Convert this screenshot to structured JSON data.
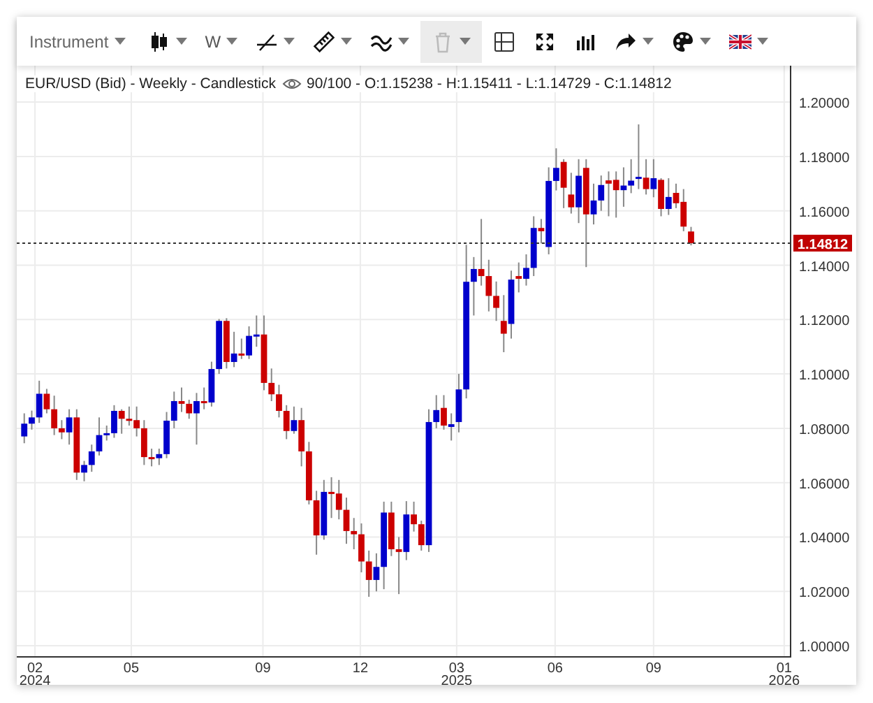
{
  "toolbar": {
    "items": [
      {
        "kind": "text",
        "label": "Instrument",
        "menu": true,
        "disabled": false
      },
      {
        "kind": "icon",
        "menu": true,
        "disabled": false
      },
      {
        "kind": "text",
        "label": "W",
        "menu": true,
        "disabled": false
      },
      {
        "kind": "icon",
        "menu": true,
        "disabled": false
      },
      {
        "kind": "icon",
        "menu": true,
        "disabled": false
      },
      {
        "kind": "icon",
        "menu": true,
        "disabled": false
      },
      {
        "kind": "icon",
        "menu": true,
        "disabled": true
      },
      {
        "kind": "icon",
        "menu": false,
        "disabled": false
      },
      {
        "kind": "icon",
        "menu": false,
        "disabled": false
      },
      {
        "kind": "icon",
        "menu": false,
        "disabled": false
      },
      {
        "kind": "icon",
        "menu": true,
        "disabled": false
      },
      {
        "kind": "icon",
        "menu": true,
        "disabled": false
      },
      {
        "kind": "icon",
        "menu": true,
        "disabled": false
      }
    ]
  },
  "chart": {
    "legend": {
      "title": "EUR/USD (Bid) - Weekly - Candlestick",
      "details": "90/100 - O:1.15238 - H:1.15411 - L:1.14729 - C:1.14812"
    },
    "year_labels": [
      "2024",
      "2025",
      "2026"
    ],
    "chart_data": {
      "type": "candlestick",
      "xlim": [
        "2024-01-15",
        "2026-01-07"
      ],
      "ylim": [
        0.9959,
        1.2134
      ],
      "yticks": [
        {
          "value": 1.2,
          "label": "1.20000"
        },
        {
          "value": 1.18,
          "label": "1.18000"
        },
        {
          "value": 1.16,
          "label": "1.16000"
        },
        {
          "value": 1.14,
          "label": "1.14000"
        },
        {
          "value": 1.12,
          "label": "1.12000"
        },
        {
          "value": 1.1,
          "label": "1.10000"
        },
        {
          "value": 1.08,
          "label": "1.08000"
        },
        {
          "value": 1.06,
          "label": "1.06000"
        },
        {
          "value": 1.04,
          "label": "1.04000"
        },
        {
          "value": 1.02,
          "label": "1.02000"
        },
        {
          "value": 1.0,
          "label": "1.00000"
        }
      ],
      "xticks": [
        {
          "value": "2024-02-01",
          "label": "02"
        },
        {
          "value": "2024-05-01",
          "label": "05"
        },
        {
          "value": "2024-09-01",
          "label": "09"
        },
        {
          "value": "2024-12-01",
          "label": "12"
        },
        {
          "value": "2025-03-01",
          "label": "03"
        },
        {
          "value": "2025-06-01",
          "label": "06"
        },
        {
          "value": "2025-09-01",
          "label": "09"
        },
        {
          "value": "2026-01-01",
          "label": "01"
        }
      ],
      "x": [
        "2024-01-22",
        "2024-01-29",
        "2024-02-05",
        "2024-02-12",
        "2024-02-19",
        "2024-02-26",
        "2024-03-04",
        "2024-03-11",
        "2024-03-18",
        "2024-03-25",
        "2024-04-01",
        "2024-04-08",
        "2024-04-15",
        "2024-04-22",
        "2024-04-29",
        "2024-05-06",
        "2024-05-13",
        "2024-05-20",
        "2024-05-27",
        "2024-06-03",
        "2024-06-10",
        "2024-06-17",
        "2024-06-24",
        "2024-07-01",
        "2024-07-08",
        "2024-07-15",
        "2024-07-22",
        "2024-07-29",
        "2024-08-05",
        "2024-08-12",
        "2024-08-19",
        "2024-08-26",
        "2024-09-02",
        "2024-09-09",
        "2024-09-16",
        "2024-09-23",
        "2024-09-30",
        "2024-10-07",
        "2024-10-14",
        "2024-10-21",
        "2024-10-28",
        "2024-11-04",
        "2024-11-11",
        "2024-11-18",
        "2024-11-25",
        "2024-12-02",
        "2024-12-09",
        "2024-12-16",
        "2024-12-23",
        "2024-12-30",
        "2025-01-06",
        "2025-01-13",
        "2025-01-20",
        "2025-01-27",
        "2025-02-03",
        "2025-02-10",
        "2025-02-17",
        "2025-02-24",
        "2025-03-03",
        "2025-03-10",
        "2025-03-17",
        "2025-03-24",
        "2025-03-31",
        "2025-04-07",
        "2025-04-14",
        "2025-04-21",
        "2025-04-28",
        "2025-05-05",
        "2025-05-12",
        "2025-05-19",
        "2025-05-26",
        "2025-06-02",
        "2025-06-09",
        "2025-06-16",
        "2025-06-23",
        "2025-06-30",
        "2025-07-07",
        "2025-07-14",
        "2025-07-21",
        "2025-07-28",
        "2025-08-04",
        "2025-08-11",
        "2025-08-18",
        "2025-08-25",
        "2025-09-01",
        "2025-09-08",
        "2025-09-15",
        "2025-09-22",
        "2025-09-29",
        "2025-10-06"
      ],
      "ohlc": [
        [
          1.077,
          1.0855,
          1.0745,
          1.0817
        ],
        [
          1.0817,
          1.0865,
          1.0795,
          1.084
        ],
        [
          1.084,
          1.0975,
          1.082,
          1.0927
        ],
        [
          1.0927,
          1.0945,
          1.0855,
          1.087
        ],
        [
          1.087,
          1.092,
          1.0775,
          1.08
        ],
        [
          1.08,
          1.083,
          1.076,
          1.0785
        ],
        [
          1.0785,
          1.087,
          1.074,
          1.084
        ],
        [
          1.084,
          1.087,
          1.061,
          1.0637
        ],
        [
          1.0637,
          1.068,
          1.0605,
          1.0665
        ],
        [
          1.0665,
          1.074,
          1.064,
          1.0715
        ],
        [
          1.0715,
          1.084,
          1.07,
          1.0775
        ],
        [
          1.0775,
          1.081,
          1.0755,
          1.0782
        ],
        [
          1.0782,
          1.0885,
          1.0765,
          1.0864
        ],
        [
          1.0864,
          1.087,
          1.078,
          1.0835
        ],
        [
          1.0835,
          1.088,
          1.081,
          1.083
        ],
        [
          1.083,
          1.088,
          1.077,
          1.08
        ],
        [
          1.08,
          1.083,
          1.0665,
          1.0694
        ],
        [
          1.0694,
          1.0725,
          1.066,
          1.069
        ],
        [
          1.069,
          1.0725,
          1.0665,
          1.0705
        ],
        [
          1.0705,
          1.086,
          1.069,
          1.0828
        ],
        [
          1.0828,
          1.0935,
          1.08,
          1.09
        ],
        [
          1.09,
          1.095,
          1.086,
          1.089
        ],
        [
          1.089,
          1.0905,
          1.0835,
          1.0855
        ],
        [
          1.0855,
          1.093,
          1.074,
          1.09
        ],
        [
          1.09,
          1.095,
          1.087,
          1.0895
        ],
        [
          1.0895,
          1.1045,
          1.088,
          1.1018
        ],
        [
          1.1018,
          1.1202,
          1.1,
          1.1195
        ],
        [
          1.1195,
          1.1205,
          1.102,
          1.1044
        ],
        [
          1.1044,
          1.1155,
          1.1025,
          1.1075
        ],
        [
          1.1075,
          1.113,
          1.1055,
          1.1068
        ],
        [
          1.1068,
          1.1175,
          1.1055,
          1.114
        ],
        [
          1.114,
          1.1215,
          1.11,
          1.1145
        ],
        [
          1.1145,
          1.1215,
          1.094,
          1.0967
        ],
        [
          1.0967,
          1.102,
          1.09,
          1.0925
        ],
        [
          1.0925,
          1.096,
          1.084,
          1.0864
        ],
        [
          1.0864,
          1.0885,
          1.076,
          1.079
        ],
        [
          1.079,
          1.088,
          1.078,
          1.083
        ],
        [
          1.083,
          1.0875,
          1.066,
          1.0715
        ],
        [
          1.0715,
          1.075,
          1.052,
          1.0535
        ],
        [
          1.0535,
          1.057,
          1.0335,
          1.0406
        ],
        [
          1.0406,
          1.061,
          1.039,
          1.0566
        ],
        [
          1.0566,
          1.062,
          1.047,
          1.056
        ],
        [
          1.056,
          1.061,
          1.0465,
          1.05
        ],
        [
          1.05,
          1.0545,
          1.0375,
          1.0422
        ],
        [
          1.0422,
          1.047,
          1.0355,
          1.041
        ],
        [
          1.041,
          1.045,
          1.027,
          1.031
        ],
        [
          1.031,
          1.035,
          1.018,
          1.0242
        ],
        [
          1.0242,
          1.034,
          1.02,
          1.029
        ],
        [
          1.029,
          1.053,
          1.0208,
          1.049
        ],
        [
          1.049,
          1.053,
          1.033,
          1.0355
        ],
        [
          1.0355,
          1.04,
          1.019,
          1.0345
        ],
        [
          1.0345,
          1.0532,
          1.0315,
          1.0483
        ],
        [
          1.0483,
          1.053,
          1.042,
          1.0447
        ],
        [
          1.0447,
          1.046,
          1.035,
          1.037
        ],
        [
          1.037,
          1.087,
          1.0345,
          1.0823
        ],
        [
          1.0823,
          1.0922,
          1.08,
          1.0867
        ],
        [
          1.0875,
          1.0922,
          1.0795,
          1.081
        ],
        [
          1.0805,
          1.0855,
          1.0755,
          1.0815
        ],
        [
          1.0823,
          1.1,
          1.0785,
          1.0943
        ],
        [
          1.0943,
          1.1475,
          1.091,
          1.1339
        ],
        [
          1.1339,
          1.143,
          1.1215,
          1.1386
        ],
        [
          1.1386,
          1.157,
          1.1325,
          1.136
        ],
        [
          1.136,
          1.142,
          1.123,
          1.1287
        ],
        [
          1.1287,
          1.134,
          1.1195,
          1.1243
        ],
        [
          1.1195,
          1.129,
          1.108,
          1.1148
        ],
        [
          1.1184,
          1.138,
          1.113,
          1.1347
        ],
        [
          1.136,
          1.141,
          1.13,
          1.135
        ],
        [
          1.135,
          1.144,
          1.1325,
          1.139
        ],
        [
          1.139,
          1.158,
          1.136,
          1.1537
        ],
        [
          1.1537,
          1.157,
          1.148,
          1.1525
        ],
        [
          1.1467,
          1.176,
          1.144,
          1.171
        ],
        [
          1.171,
          1.183,
          1.1675,
          1.1758
        ],
        [
          1.178,
          1.179,
          1.161,
          1.1685
        ],
        [
          1.166,
          1.174,
          1.159,
          1.1613
        ],
        [
          1.1613,
          1.179,
          1.1555,
          1.1729
        ],
        [
          1.1758,
          1.179,
          1.1393,
          1.1587
        ],
        [
          1.1587,
          1.17,
          1.155,
          1.1638
        ],
        [
          1.1638,
          1.173,
          1.16,
          1.1695
        ],
        [
          1.1712,
          1.1745,
          1.158,
          1.17
        ],
        [
          1.1714,
          1.1745,
          1.1575,
          1.1676
        ],
        [
          1.1676,
          1.176,
          1.1615,
          1.1693
        ],
        [
          1.1693,
          1.179,
          1.1665,
          1.1711
        ],
        [
          1.172,
          1.1918,
          1.168,
          1.1725
        ],
        [
          1.1722,
          1.179,
          1.166,
          1.168
        ],
        [
          1.168,
          1.179,
          1.165,
          1.172
        ],
        [
          1.1714,
          1.172,
          1.158,
          1.1607
        ],
        [
          1.1607,
          1.172,
          1.1585,
          1.1651
        ],
        [
          1.1666,
          1.17,
          1.161,
          1.1628
        ],
        [
          1.1633,
          1.168,
          1.1525,
          1.1542
        ],
        [
          1.1524,
          1.1541,
          1.1473,
          1.1481
        ]
      ],
      "grid": true,
      "ref_lines": [
        {
          "axis": "y",
          "value": 1.14812,
          "label": "1.14812"
        }
      ]
    }
  }
}
